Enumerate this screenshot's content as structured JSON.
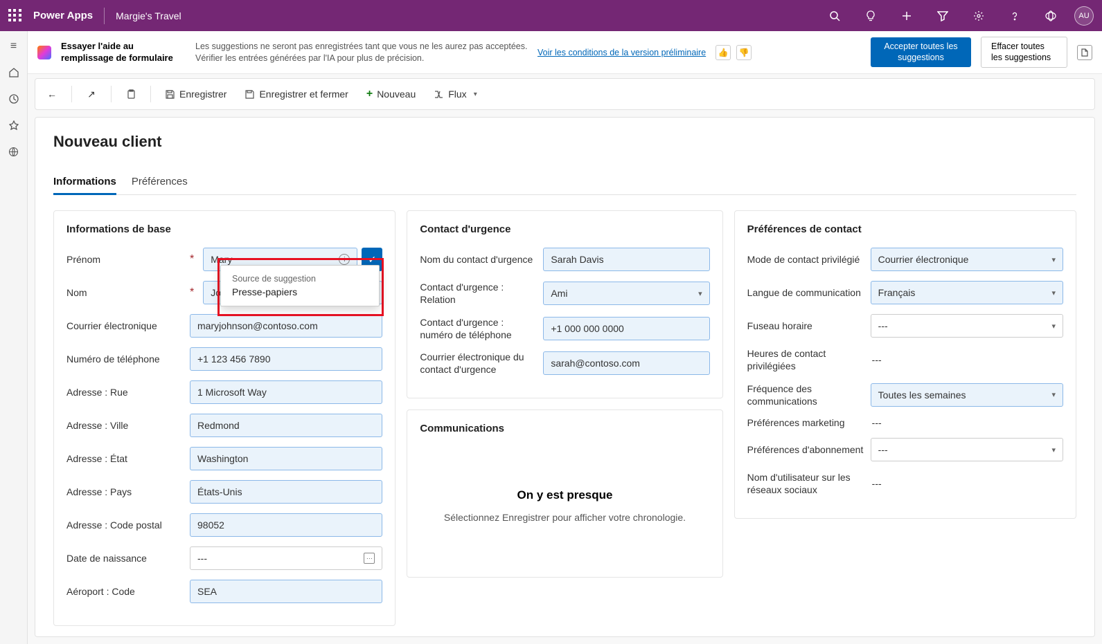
{
  "topbar": {
    "brand": "Power Apps",
    "env": "Margie's Travel",
    "avatar": "AU"
  },
  "aibar": {
    "title": "Essayer l'aide au remplissage de formulaire",
    "desc": "Les suggestions ne seront pas enregistrées tant que vous ne les aurez pas acceptées. Vérifier les entrées générées par l'IA pour plus de précision.",
    "link": "Voir les conditions de la version préliminaire",
    "accept": "Accepter toutes les suggestions",
    "clear": "Effacer toutes les suggestions"
  },
  "cmdbar": {
    "save": "Enregistrer",
    "saveclose": "Enregistrer et fermer",
    "new": "Nouveau",
    "flow": "Flux"
  },
  "page": {
    "title": "Nouveau client"
  },
  "tabs": {
    "t1": "Informations",
    "t2": "Préférences"
  },
  "sections": {
    "basic": "Informations de base",
    "emergency": "Contact d'urgence",
    "comms": "Communications",
    "prefs": "Préférences de contact"
  },
  "basic": {
    "firstname_l": "Prénom",
    "firstname": "Mary",
    "lastname_l": "Nom",
    "lastname": "Johnson",
    "email_l": "Courrier électronique",
    "email": "maryjohnson@contoso.com",
    "phone_l": "Numéro de téléphone",
    "phone": "+1 123 456 7890",
    "street_l": "Adresse : Rue",
    "street": "1 Microsoft Way",
    "city_l": "Adresse : Ville",
    "city": "Redmond",
    "state_l": "Adresse : État",
    "state": "Washington",
    "country_l": "Adresse : Pays",
    "country": "États-Unis",
    "zip_l": "Adresse : Code postal",
    "zip": "98052",
    "dob_l": "Date de naissance",
    "dob": "---",
    "airport_l": "Aéroport : Code",
    "airport": "SEA"
  },
  "emerg": {
    "name_l": "Nom du contact d'urgence",
    "name": "Sarah Davis",
    "rel_l": "Contact d'urgence : Relation",
    "rel": "Ami",
    "phone_l": "Contact d'urgence : numéro de téléphone",
    "phone": "+1 000 000 0000",
    "email_l": "Courrier électronique du contact d'urgence",
    "email": "sarah@contoso.com"
  },
  "comm": {
    "h": "On y est presque",
    "p": "Sélectionnez Enregistrer pour afficher votre chronologie."
  },
  "prefs": {
    "mode_l": "Mode de contact privilégié",
    "mode": "Courrier électronique",
    "lang_l": "Langue de communication",
    "lang": "Français",
    "tz_l": "Fuseau horaire",
    "tz": "---",
    "hours_l": "Heures de contact privilégiées",
    "hours": "---",
    "freq_l": "Fréquence des communications",
    "freq": "Toutes les semaines",
    "mkt_l": "Préférences marketing",
    "mkt": "---",
    "sub_l": "Préférences d'abonnement",
    "sub": "---",
    "social_l": "Nom d'utilisateur sur les réseaux sociaux",
    "social": "---"
  },
  "tooltip": {
    "l1": "Source de suggestion",
    "l2": "Presse-papiers"
  }
}
